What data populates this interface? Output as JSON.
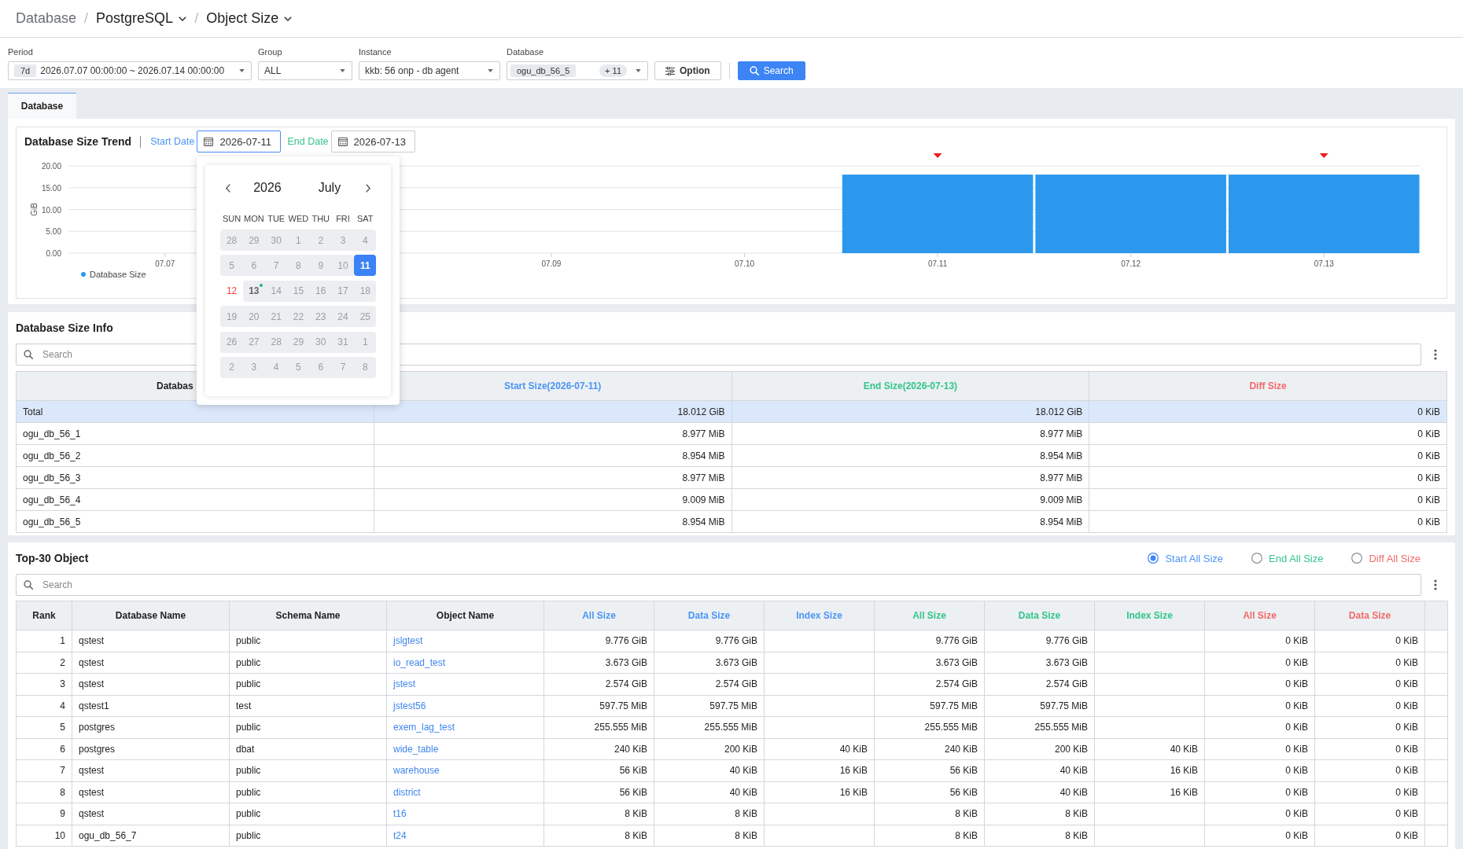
{
  "breadcrumb": [
    {
      "label": "Database",
      "kind": "link"
    },
    {
      "label": "/",
      "kind": "separator"
    },
    {
      "label": "PostgreSQL",
      "kind": "dropdown"
    },
    {
      "label": "/",
      "kind": "separator"
    },
    {
      "label": "Object Size",
      "kind": "dropdown"
    }
  ],
  "filter_bar": {
    "fields": [
      {
        "label": "Period",
        "kind": "period",
        "badge": "7d",
        "value": "2026.07.07 00:00:00 ~ 2026.07.14 00:00:00"
      },
      {
        "label": "Group",
        "kind": "select",
        "value": "ALL"
      },
      {
        "label": "Instance",
        "kind": "select",
        "value": "kkb: 56 onp - db agent"
      },
      {
        "label": "Database",
        "kind": "multi",
        "chip": "ogu_db_56_5",
        "count": "+ 11"
      }
    ],
    "buttons": [
      {
        "label": "Option",
        "kind": "option"
      },
      {
        "label": "Search",
        "kind": "search"
      }
    ]
  },
  "tabs": [
    {
      "label": "Database",
      "selected": true
    }
  ],
  "trend": {
    "title": "Database Size Trend",
    "date_fields": [
      {
        "label": "Start Date",
        "value": "2026-07-11",
        "focused": true,
        "color": "#4b95f5"
      },
      {
        "label": "End Date",
        "value": "2026-07-13",
        "focused": false,
        "color": "#33c58a"
      }
    ],
    "chart_data": {
      "type": "bar",
      "ylabel": "GiB",
      "categories": [
        "07.07",
        null,
        "07.09",
        "07.10",
        "07.11",
        "07.12",
        "07.13"
      ],
      "series": [
        {
          "name": "Database Size",
          "color": "#2b98ee",
          "values": [
            null,
            null,
            null,
            null,
            18,
            18,
            18
          ]
        }
      ],
      "ylim": [
        0,
        20
      ],
      "yticks": [
        {
          "value": 0,
          "label": "0.00"
        },
        {
          "value": 5,
          "label": "5.00"
        },
        {
          "value": 10,
          "label": "10.00"
        },
        {
          "value": 15,
          "label": "15.00"
        },
        {
          "value": 20,
          "label": "20.00"
        }
      ],
      "grid": true,
      "annotations": [
        {
          "x": "07.11"
        },
        {
          "x": "07.13"
        }
      ]
    },
    "calendar": {
      "year": "2026",
      "month": "July",
      "weekdays": [
        "SUN",
        "MON",
        "TUE",
        "WED",
        "THU",
        "FRI",
        "SAT"
      ],
      "weeks": [
        [
          {
            "label": "28",
            "selected": false,
            "disabled": true,
            "today": false,
            "marked": false
          },
          {
            "label": "29",
            "selected": false,
            "disabled": true,
            "today": false,
            "marked": false
          },
          {
            "label": "30",
            "selected": false,
            "disabled": true,
            "today": false,
            "marked": false
          },
          {
            "label": "1",
            "selected": false,
            "disabled": true,
            "today": false,
            "marked": false
          },
          {
            "label": "2",
            "selected": false,
            "disabled": true,
            "today": false,
            "marked": false
          },
          {
            "label": "3",
            "selected": false,
            "disabled": true,
            "today": false,
            "marked": false
          },
          {
            "label": "4",
            "selected": false,
            "disabled": true,
            "today": false,
            "marked": false
          }
        ],
        [
          {
            "label": "5",
            "selected": false,
            "disabled": true,
            "today": false,
            "marked": false
          },
          {
            "label": "6",
            "selected": false,
            "disabled": true,
            "today": false,
            "marked": false
          },
          {
            "label": "7",
            "selected": false,
            "disabled": true,
            "today": false,
            "marked": false
          },
          {
            "label": "8",
            "selected": false,
            "disabled": true,
            "today": false,
            "marked": false
          },
          {
            "label": "9",
            "selected": false,
            "disabled": true,
            "today": false,
            "marked": false
          },
          {
            "label": "10",
            "selected": false,
            "disabled": true,
            "today": false,
            "marked": false
          },
          {
            "label": "11",
            "selected": true,
            "disabled": false,
            "today": false,
            "marked": false
          }
        ],
        [
          {
            "label": "12",
            "selected": false,
            "disabled": false,
            "today": true,
            "marked": false
          },
          {
            "label": "13",
            "selected": false,
            "disabled": true,
            "today": false,
            "marked": true
          },
          {
            "label": "14",
            "selected": false,
            "disabled": true,
            "today": false,
            "marked": false
          },
          {
            "label": "15",
            "selected": false,
            "disabled": true,
            "today": false,
            "marked": false
          },
          {
            "label": "16",
            "selected": false,
            "disabled": true,
            "today": false,
            "marked": false
          },
          {
            "label": "17",
            "selected": false,
            "disabled": true,
            "today": false,
            "marked": false
          },
          {
            "label": "18",
            "selected": false,
            "disabled": true,
            "today": false,
            "marked": false
          }
        ],
        [
          {
            "label": "19",
            "selected": false,
            "disabled": true,
            "today": false,
            "marked": false
          },
          {
            "label": "20",
            "selected": false,
            "disabled": true,
            "today": false,
            "marked": false
          },
          {
            "label": "21",
            "selected": false,
            "disabled": true,
            "today": false,
            "marked": false
          },
          {
            "label": "22",
            "selected": false,
            "disabled": true,
            "today": false,
            "marked": false
          },
          {
            "label": "23",
            "selected": false,
            "disabled": true,
            "today": false,
            "marked": false
          },
          {
            "label": "24",
            "selected": false,
            "disabled": true,
            "today": false,
            "marked": false
          },
          {
            "label": "25",
            "selected": false,
            "disabled": true,
            "today": false,
            "marked": false
          }
        ],
        [
          {
            "label": "26",
            "selected": false,
            "disabled": true,
            "today": false,
            "marked": false
          },
          {
            "label": "27",
            "selected": false,
            "disabled": true,
            "today": false,
            "marked": false
          },
          {
            "label": "28",
            "selected": false,
            "disabled": true,
            "today": false,
            "marked": false
          },
          {
            "label": "29",
            "selected": false,
            "disabled": true,
            "today": false,
            "marked": false
          },
          {
            "label": "30",
            "selected": false,
            "disabled": true,
            "today": false,
            "marked": false
          },
          {
            "label": "31",
            "selected": false,
            "disabled": true,
            "today": false,
            "marked": false
          },
          {
            "label": "1",
            "selected": false,
            "disabled": true,
            "today": false,
            "marked": false
          }
        ],
        [
          {
            "label": "2",
            "selected": false,
            "disabled": true,
            "today": false,
            "marked": false
          },
          {
            "label": "3",
            "selected": false,
            "disabled": true,
            "today": false,
            "marked": false
          },
          {
            "label": "4",
            "selected": false,
            "disabled": true,
            "today": false,
            "marked": false
          },
          {
            "label": "5",
            "selected": false,
            "disabled": true,
            "today": false,
            "marked": false
          },
          {
            "label": "6",
            "selected": false,
            "disabled": true,
            "today": false,
            "marked": false
          },
          {
            "label": "7",
            "selected": false,
            "disabled": true,
            "today": false,
            "marked": false
          },
          {
            "label": "8",
            "selected": false,
            "disabled": true,
            "today": false,
            "marked": false
          }
        ]
      ]
    }
  },
  "size_info": {
    "title": "Database Size Info",
    "search": {
      "placeholder": "Search"
    },
    "columns": [
      {
        "label": "Databas",
        "kind": "text",
        "color": "#222222"
      },
      {
        "label": "Start Size(2026-07-11)",
        "kind": "number",
        "color": "#4b95f5"
      },
      {
        "label": "End Size(2026-07-13)",
        "kind": "number",
        "color": "#33c58a"
      },
      {
        "label": "Diff Size",
        "kind": "number",
        "color": "#f26a6a"
      }
    ],
    "rows": [
      {
        "cells": [
          "Total",
          "18.012 GiB",
          "18.012 GiB",
          "0 KiB"
        ],
        "selected": true
      },
      {
        "cells": [
          "ogu_db_56_1",
          "8.977 MiB",
          "8.977 MiB",
          "0 KiB"
        ],
        "selected": false
      },
      {
        "cells": [
          "ogu_db_56_2",
          "8.954 MiB",
          "8.954 MiB",
          "0 KiB"
        ],
        "selected": false
      },
      {
        "cells": [
          "ogu_db_56_3",
          "8.977 MiB",
          "8.977 MiB",
          "0 KiB"
        ],
        "selected": false
      },
      {
        "cells": [
          "ogu_db_56_4",
          "9.009 MiB",
          "9.009 MiB",
          "0 KiB"
        ],
        "selected": false
      },
      {
        "cells": [
          "ogu_db_56_5",
          "8.954 MiB",
          "8.954 MiB",
          "0 KiB"
        ],
        "selected": false
      }
    ]
  },
  "top_objects": {
    "title": "Top-30 Object",
    "size_options": [
      {
        "label": "Start All Size",
        "selected": true,
        "color": "#4b95f5"
      },
      {
        "label": "End All Size",
        "selected": false,
        "color": "#33c58a"
      },
      {
        "label": "Diff All Size",
        "selected": false,
        "color": "#f26a6a"
      }
    ],
    "search": {
      "placeholder": "Search"
    },
    "columns": [
      {
        "label": "Rank",
        "kind": "rank",
        "color": "#222222"
      },
      {
        "label": "Database Name",
        "kind": "text",
        "color": "#222222"
      },
      {
        "label": "Schema Name",
        "kind": "text",
        "color": "#222222"
      },
      {
        "label": "Object Name",
        "kind": "link",
        "color": "#222222"
      },
      {
        "label": "All Size",
        "kind": "number",
        "color": "#4b95f5"
      },
      {
        "label": "Data Size",
        "kind": "number",
        "color": "#4b95f5"
      },
      {
        "label": "Index Size",
        "kind": "number",
        "color": "#4b95f5"
      },
      {
        "label": "All Size",
        "kind": "number",
        "color": "#33c58a"
      },
      {
        "label": "Data Size",
        "kind": "number",
        "color": "#33c58a"
      },
      {
        "label": "Index Size",
        "kind": "number",
        "color": "#33c58a"
      },
      {
        "label": "All Size",
        "kind": "number",
        "color": "#f26a6a"
      },
      {
        "label": "Data Size",
        "kind": "number",
        "color": "#f26a6a"
      }
    ],
    "rows": [
      [
        "1",
        "qstest",
        "public",
        "jslgtest",
        "9.776 GiB",
        "9.776 GiB",
        null,
        "9.776 GiB",
        "9.776 GiB",
        null,
        "0 KiB",
        "0 KiB"
      ],
      [
        "2",
        "qstest",
        "public",
        "io_read_test",
        "3.673 GiB",
        "3.673 GiB",
        null,
        "3.673 GiB",
        "3.673 GiB",
        null,
        "0 KiB",
        "0 KiB"
      ],
      [
        "3",
        "qstest",
        "public",
        "jstest",
        "2.574 GiB",
        "2.574 GiB",
        null,
        "2.574 GiB",
        "2.574 GiB",
        null,
        "0 KiB",
        "0 KiB"
      ],
      [
        "4",
        "qstest1",
        "test",
        "jstest56",
        "597.75 MiB",
        "597.75 MiB",
        null,
        "597.75 MiB",
        "597.75 MiB",
        null,
        "0 KiB",
        "0 KiB"
      ],
      [
        "5",
        "postgres",
        "public",
        "exem_lag_test",
        "255.555 MiB",
        "255.555 MiB",
        null,
        "255.555 MiB",
        "255.555 MiB",
        null,
        "0 KiB",
        "0 KiB"
      ],
      [
        "6",
        "postgres",
        "dbat",
        "wide_table",
        "240 KiB",
        "200 KiB",
        "40 KiB",
        "240 KiB",
        "200 KiB",
        "40 KiB",
        "0 KiB",
        "0 KiB"
      ],
      [
        "7",
        "qstest",
        "public",
        "warehouse",
        "56 KiB",
        "40 KiB",
        "16 KiB",
        "56 KiB",
        "40 KiB",
        "16 KiB",
        "0 KiB",
        "0 KiB"
      ],
      [
        "8",
        "qstest",
        "public",
        "district",
        "56 KiB",
        "40 KiB",
        "16 KiB",
        "56 KiB",
        "40 KiB",
        "16 KiB",
        "0 KiB",
        "0 KiB"
      ],
      [
        "9",
        "qstest",
        "public",
        "t16",
        "8 KiB",
        "8 KiB",
        null,
        "8 KiB",
        "8 KiB",
        null,
        "0 KiB",
        "0 KiB"
      ],
      [
        "10",
        "ogu_db_56_7",
        "public",
        "t24",
        "8 KiB",
        "8 KiB",
        null,
        "8 KiB",
        "8 KiB",
        null,
        "0 KiB",
        "0 KiB"
      ]
    ]
  }
}
